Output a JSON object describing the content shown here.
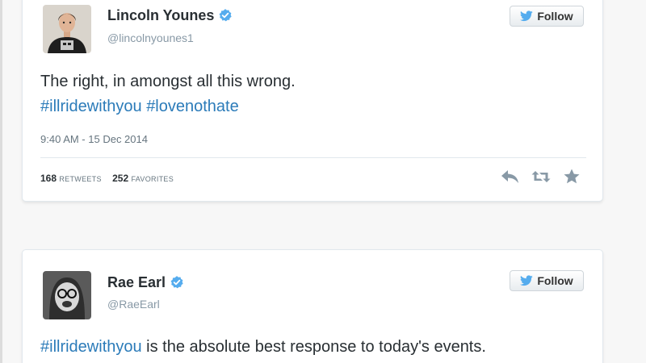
{
  "tweets": [
    {
      "name": "Lincoln Younes",
      "handle": "@lincolnyounes1",
      "follow_label": "Follow",
      "text_plain": "The right, in amongst all this wrong.",
      "hashtags": [
        "#illridewithyou",
        "#lovenothate"
      ],
      "time": "9:40 AM - 15 Dec 2014",
      "retweets_count": "168",
      "retweets_label": "RETWEETS",
      "favorites_count": "252",
      "favorites_label": "FAVORITES",
      "actions": [
        "reply-icon",
        "retweet-icon",
        "favorite-icon"
      ]
    },
    {
      "name": "Rae Earl",
      "handle": "@RaeEarl",
      "follow_label": "Follow",
      "hashtag": "#illridewithyou",
      "text_rest": " is the absolute best response to today's events."
    }
  ],
  "colors": {
    "verified": "#55acee",
    "hashtag": "#2b7bb9",
    "text": "#292f33",
    "muted": "#66757f",
    "icon_gray": "#8899a6"
  }
}
